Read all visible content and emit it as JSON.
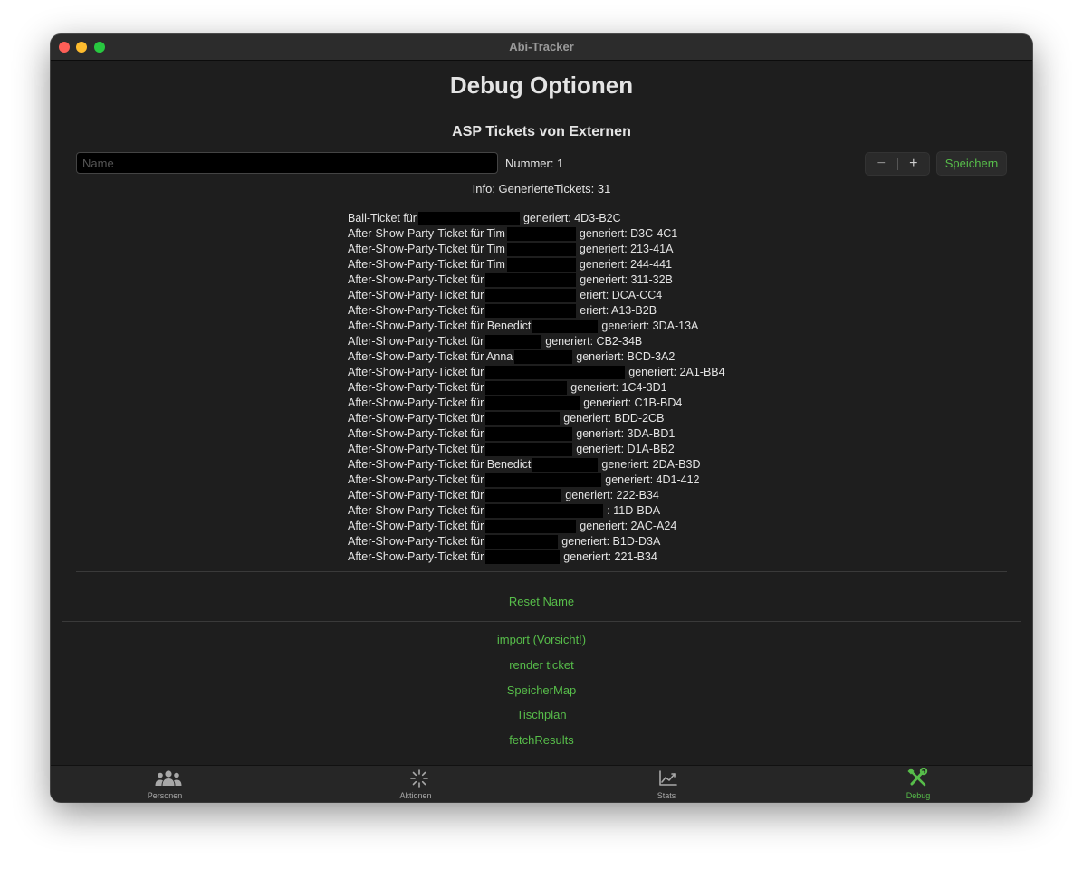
{
  "window": {
    "title": "Abi-Tracker"
  },
  "page": {
    "title": "Debug Optionen",
    "section_title": "ASP Tickets von Externen"
  },
  "form": {
    "name_placeholder": "Name",
    "name_value": "",
    "nummer_label": "Nummer: 1",
    "stepper_minus": "−",
    "stepper_plus": "+",
    "save_label": "Speichern"
  },
  "info": "Info: GenerierteTickets: 31",
  "tickets": [
    {
      "prefix": "Ball-Ticket für",
      "code": "generiert: 4D3-B2C"
    },
    {
      "prefix": "After-Show-Party-Ticket für Tim",
      "code": "generiert: D3C-4C1"
    },
    {
      "prefix": "After-Show-Party-Ticket für Tim",
      "code": "generiert: 213-41A"
    },
    {
      "prefix": "After-Show-Party-Ticket für Tim",
      "code": "generiert: 244-441"
    },
    {
      "prefix": "After-Show-Party-Ticket für",
      "code": "generiert: 311-32B"
    },
    {
      "prefix": "After-Show-Party-Ticket für",
      "code": "eriert: DCA-CC4"
    },
    {
      "prefix": "After-Show-Party-Ticket für",
      "code": "eriert: A13-B2B"
    },
    {
      "prefix": "After-Show-Party-Ticket für Benedict",
      "code": "generiert: 3DA-13A"
    },
    {
      "prefix": "After-Show-Party-Ticket für",
      "code": "generiert: CB2-34B"
    },
    {
      "prefix": "After-Show-Party-Ticket für Anna",
      "code": "generiert: BCD-3A2"
    },
    {
      "prefix": "After-Show-Party-Ticket für",
      "code": "generiert: 2A1-BB4"
    },
    {
      "prefix": "After-Show-Party-Ticket für",
      "code": "generiert: 1C4-3D1"
    },
    {
      "prefix": "After-Show-Party-Ticket für",
      "code": "generiert: C1B-BD4"
    },
    {
      "prefix": "After-Show-Party-Ticket für",
      "code": "generiert: BDD-2CB"
    },
    {
      "prefix": "After-Show-Party-Ticket für",
      "code": "generiert: 3DA-BD1"
    },
    {
      "prefix": "After-Show-Party-Ticket für",
      "code": "generiert: D1A-BB2"
    },
    {
      "prefix": "After-Show-Party-Ticket für Benedict",
      "code": "generiert: 2DA-B3D"
    },
    {
      "prefix": "After-Show-Party-Ticket für",
      "code": "generiert: 4D1-412"
    },
    {
      "prefix": "After-Show-Party-Ticket für",
      "code": "generiert: 222-B34"
    },
    {
      "prefix": "After-Show-Party-Ticket für",
      "code": ": 11D-BDA"
    },
    {
      "prefix": "After-Show-Party-Ticket für",
      "code": "generiert: 2AC-A24"
    },
    {
      "prefix": "After-Show-Party-Ticket für",
      "code": "generiert: B1D-D3A"
    },
    {
      "prefix": "After-Show-Party-Ticket für",
      "code": "generiert: 221-B34"
    }
  ],
  "actions": {
    "reset_name": "Reset Name",
    "import": "import (Vorsicht!)",
    "render_ticket": "render ticket",
    "speicher_map": "SpeicherMap",
    "tischplan": "Tischplan",
    "fetch_results": "fetchResults"
  },
  "tabs": [
    {
      "label": "Personen",
      "icon": "people-icon",
      "active": false
    },
    {
      "label": "Aktionen",
      "icon": "sparkle-icon",
      "active": false
    },
    {
      "label": "Stats",
      "icon": "chart-icon",
      "active": false
    },
    {
      "label": "Debug",
      "icon": "tools-icon",
      "active": true
    }
  ],
  "colors": {
    "accent": "#57bd4a",
    "background": "#1e1e1e",
    "text": "#e4e4e4"
  }
}
